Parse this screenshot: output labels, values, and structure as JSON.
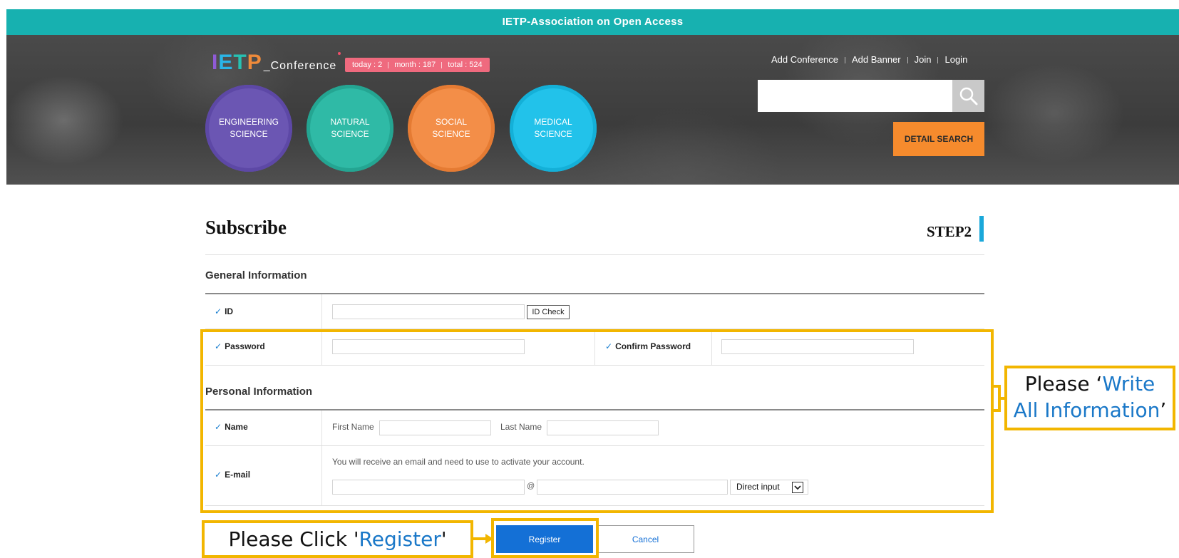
{
  "topbar": {
    "title": "IETP-Association on Open Access"
  },
  "logo": {
    "letters": [
      "I",
      "E",
      "T",
      "P"
    ],
    "suffix": "_Conference"
  },
  "stats": {
    "today": "today : 2",
    "month": "month : 187",
    "total": "total : 524"
  },
  "categories": [
    {
      "line1": "ENGINEERING",
      "line2": "SCIENCE"
    },
    {
      "line1": "NATURAL",
      "line2": "SCIENCE"
    },
    {
      "line1": "SOCIAL",
      "line2": "SCIENCE"
    },
    {
      "line1": "MEDICAL",
      "line2": "SCIENCE"
    }
  ],
  "toplinks": {
    "add_conference": "Add Conference",
    "add_banner": "Add Banner",
    "join": "Join",
    "login": "Login"
  },
  "search": {
    "placeholder": "",
    "detail_label": "DETAIL SEARCH"
  },
  "page": {
    "title": "Subscribe",
    "step": "STEP2"
  },
  "sections": {
    "general": "General Information",
    "personal": "Personal Information"
  },
  "fields": {
    "id_label": "ID",
    "id_check": "ID Check",
    "password_label": "Password",
    "confirm_password_label": "Confirm Password",
    "name_label": "Name",
    "first_name": "First Name",
    "last_name": "Last Name",
    "email_label": "E-mail",
    "email_note": "You will receive an email and need to use to activate your account.",
    "at": "@",
    "domain_select": "Direct input"
  },
  "buttons": {
    "register": "Register",
    "cancel": "Cancel"
  },
  "annotations": {
    "click_prefix": "Please Click '",
    "click_highlight": "Register",
    "click_suffix": "'",
    "write_prefix": "Please ‘",
    "write_highlight_1": "Write",
    "write_highlight_2": "All Information",
    "write_suffix": "’"
  },
  "colors": {
    "topbar": "#17b1b0",
    "annotation": "#f2b600",
    "register": "#1470d6",
    "detail_search": "#f68b2d",
    "stats_badge": "#ef6a7e"
  }
}
